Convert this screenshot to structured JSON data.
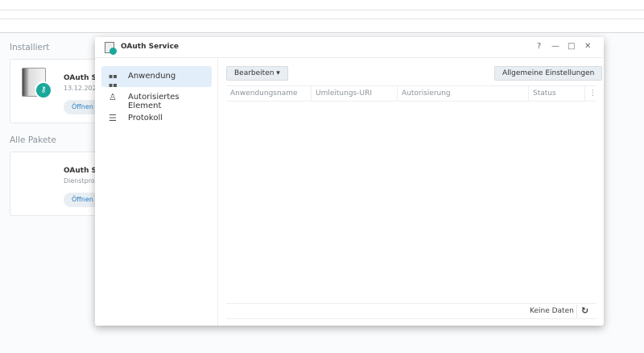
{
  "background": {
    "installed_heading": "Installiert",
    "installed_card": {
      "title": "OAuth S",
      "date": "13.12.202",
      "open_label": "Öffnen"
    },
    "all_heading": "Alle Pakete",
    "all_card": {
      "title": "OAuth S",
      "subtitle": "Dienstpro",
      "open_label": "Öffnen"
    }
  },
  "window": {
    "title": "OAuth Service",
    "controls": {
      "help": "?",
      "minimize": "—",
      "maximize": "□",
      "close": "✕"
    },
    "sidebar": [
      {
        "label": "Anwendung",
        "icon": "grid-icon",
        "glyph": "▪▪"
      },
      {
        "label": "Autorisiertes Element",
        "icon": "user-icon",
        "glyph": "♙"
      },
      {
        "label": "Protokoll",
        "icon": "list-icon",
        "glyph": "☰"
      }
    ],
    "toolbar": {
      "edit_label": "Bearbeiten ▾",
      "settings_label": "Allgemeine Einstellungen"
    },
    "table": {
      "columns": [
        "Anwendungsname",
        "Umleitungs-URI",
        "Autorisierung",
        "Status"
      ],
      "more": "⋮"
    },
    "footer": {
      "status": "Keine Daten",
      "refresh": "↻"
    }
  }
}
